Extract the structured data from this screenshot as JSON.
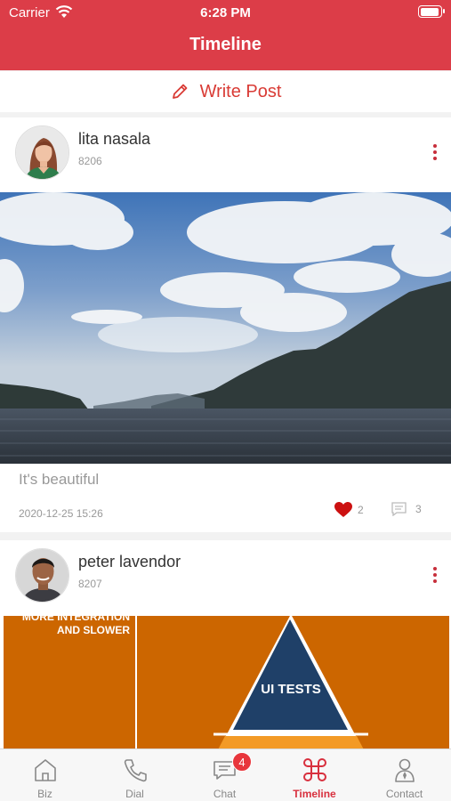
{
  "status_bar": {
    "carrier": "Carrier",
    "time": "6:28 PM",
    "battery_level": 0.95
  },
  "header": {
    "title": "Timeline"
  },
  "write_post": {
    "label": "Write Post"
  },
  "posts": [
    {
      "author": "lita nasala",
      "author_id": "8206",
      "text": "It's beautiful",
      "date": "2020-12-25 15:26",
      "likes": "2",
      "comments": "3"
    },
    {
      "author": "peter lavendor",
      "author_id": "8207",
      "slide_text_1": "MORE INTEGRATION",
      "slide_text_2": "AND SLOWER",
      "slide_label": "UI TESTS"
    }
  ],
  "tabs": [
    {
      "label": "Biz",
      "icon": "home-icon"
    },
    {
      "label": "Dial",
      "icon": "phone-icon"
    },
    {
      "label": "Chat",
      "icon": "chat-icon",
      "badge": "4"
    },
    {
      "label": "Timeline",
      "icon": "command-icon",
      "active": true
    },
    {
      "label": "Contact",
      "icon": "contact-icon"
    }
  ],
  "colors": {
    "accent": "#dc3d48",
    "active_tab": "#d8303e",
    "like": "#cc1111"
  }
}
